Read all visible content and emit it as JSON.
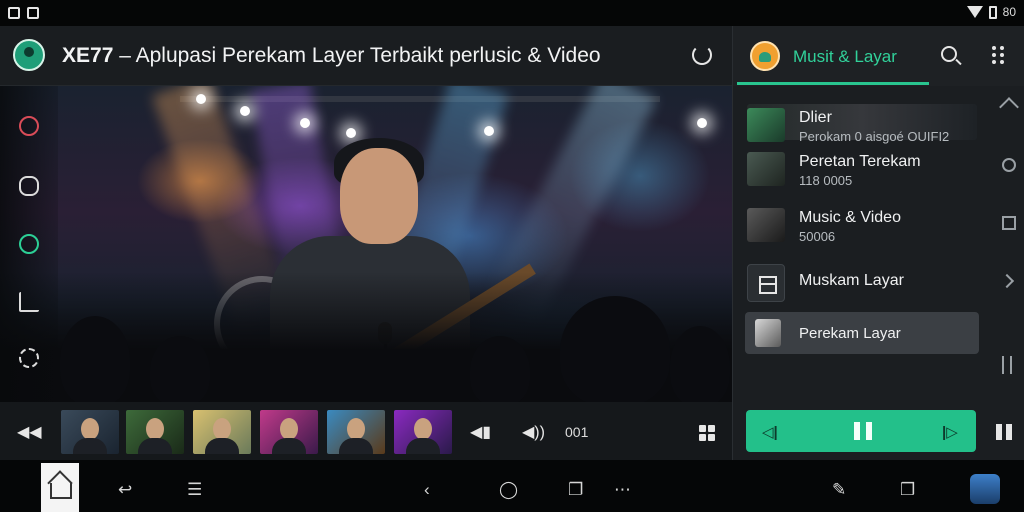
{
  "status_bar": {
    "right_text": "80"
  },
  "header": {
    "brand": "XE77",
    "separator": "–",
    "title": "Aplupasi Perekam Layer Terbaikt perlusic & Video"
  },
  "right_panel": {
    "title": "Musit & Layar",
    "items": [
      {
        "line1": "Dlier",
        "line2": "Perokam 0 aisgoé OUIFI2"
      },
      {
        "line1": "Peretan Terekam",
        "line2": "118 0005"
      },
      {
        "line1": "Music & Video",
        "line2": "50006"
      },
      {
        "line1": "Muskam Layar",
        "line2": ""
      },
      {
        "line1": "Perekam Layar",
        "line2": ""
      }
    ]
  },
  "bottom_bar": {
    "counter_label": "001"
  },
  "colors": {
    "accent": "#23c08a",
    "panel": "#1b1e21",
    "header": "#1a1d20"
  },
  "icons": {
    "left_rail": [
      "heart-icon",
      "share-icon",
      "record-icon",
      "edit-icon",
      "settings-icon"
    ],
    "right_rail": [
      "collapse-icon",
      "search-icon",
      "square-icon",
      "chevron-right-icon",
      "list-icon"
    ],
    "nav": [
      "home-icon",
      "back-icon",
      "menu-icon",
      "chevron-left-icon",
      "chat-icon",
      "windows-icon",
      "more-icon",
      "pen-icon",
      "tab-icon"
    ]
  }
}
